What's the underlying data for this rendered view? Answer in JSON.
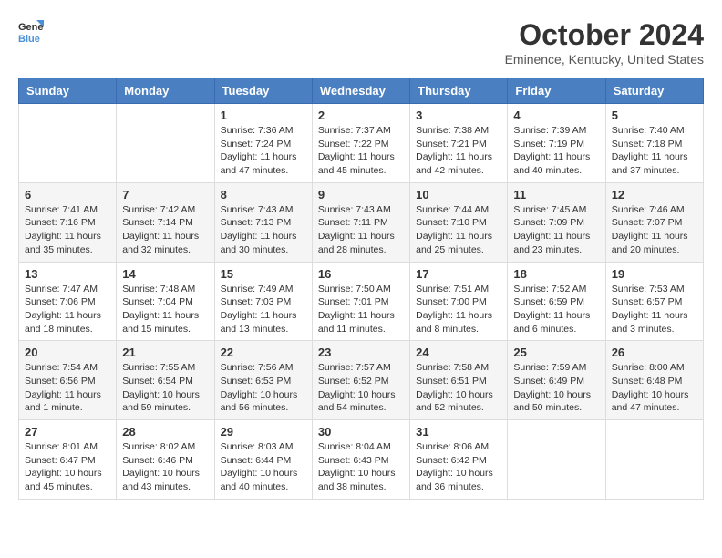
{
  "header": {
    "logo_general": "General",
    "logo_blue": "Blue",
    "month_year": "October 2024",
    "location": "Eminence, Kentucky, United States"
  },
  "weekdays": [
    "Sunday",
    "Monday",
    "Tuesday",
    "Wednesday",
    "Thursday",
    "Friday",
    "Saturday"
  ],
  "weeks": [
    [
      {
        "day": "",
        "info": ""
      },
      {
        "day": "",
        "info": ""
      },
      {
        "day": "1",
        "info": "Sunrise: 7:36 AM\nSunset: 7:24 PM\nDaylight: 11 hours and 47 minutes."
      },
      {
        "day": "2",
        "info": "Sunrise: 7:37 AM\nSunset: 7:22 PM\nDaylight: 11 hours and 45 minutes."
      },
      {
        "day": "3",
        "info": "Sunrise: 7:38 AM\nSunset: 7:21 PM\nDaylight: 11 hours and 42 minutes."
      },
      {
        "day": "4",
        "info": "Sunrise: 7:39 AM\nSunset: 7:19 PM\nDaylight: 11 hours and 40 minutes."
      },
      {
        "day": "5",
        "info": "Sunrise: 7:40 AM\nSunset: 7:18 PM\nDaylight: 11 hours and 37 minutes."
      }
    ],
    [
      {
        "day": "6",
        "info": "Sunrise: 7:41 AM\nSunset: 7:16 PM\nDaylight: 11 hours and 35 minutes."
      },
      {
        "day": "7",
        "info": "Sunrise: 7:42 AM\nSunset: 7:14 PM\nDaylight: 11 hours and 32 minutes."
      },
      {
        "day": "8",
        "info": "Sunrise: 7:43 AM\nSunset: 7:13 PM\nDaylight: 11 hours and 30 minutes."
      },
      {
        "day": "9",
        "info": "Sunrise: 7:43 AM\nSunset: 7:11 PM\nDaylight: 11 hours and 28 minutes."
      },
      {
        "day": "10",
        "info": "Sunrise: 7:44 AM\nSunset: 7:10 PM\nDaylight: 11 hours and 25 minutes."
      },
      {
        "day": "11",
        "info": "Sunrise: 7:45 AM\nSunset: 7:09 PM\nDaylight: 11 hours and 23 minutes."
      },
      {
        "day": "12",
        "info": "Sunrise: 7:46 AM\nSunset: 7:07 PM\nDaylight: 11 hours and 20 minutes."
      }
    ],
    [
      {
        "day": "13",
        "info": "Sunrise: 7:47 AM\nSunset: 7:06 PM\nDaylight: 11 hours and 18 minutes."
      },
      {
        "day": "14",
        "info": "Sunrise: 7:48 AM\nSunset: 7:04 PM\nDaylight: 11 hours and 15 minutes."
      },
      {
        "day": "15",
        "info": "Sunrise: 7:49 AM\nSunset: 7:03 PM\nDaylight: 11 hours and 13 minutes."
      },
      {
        "day": "16",
        "info": "Sunrise: 7:50 AM\nSunset: 7:01 PM\nDaylight: 11 hours and 11 minutes."
      },
      {
        "day": "17",
        "info": "Sunrise: 7:51 AM\nSunset: 7:00 PM\nDaylight: 11 hours and 8 minutes."
      },
      {
        "day": "18",
        "info": "Sunrise: 7:52 AM\nSunset: 6:59 PM\nDaylight: 11 hours and 6 minutes."
      },
      {
        "day": "19",
        "info": "Sunrise: 7:53 AM\nSunset: 6:57 PM\nDaylight: 11 hours and 3 minutes."
      }
    ],
    [
      {
        "day": "20",
        "info": "Sunrise: 7:54 AM\nSunset: 6:56 PM\nDaylight: 11 hours and 1 minute."
      },
      {
        "day": "21",
        "info": "Sunrise: 7:55 AM\nSunset: 6:54 PM\nDaylight: 10 hours and 59 minutes."
      },
      {
        "day": "22",
        "info": "Sunrise: 7:56 AM\nSunset: 6:53 PM\nDaylight: 10 hours and 56 minutes."
      },
      {
        "day": "23",
        "info": "Sunrise: 7:57 AM\nSunset: 6:52 PM\nDaylight: 10 hours and 54 minutes."
      },
      {
        "day": "24",
        "info": "Sunrise: 7:58 AM\nSunset: 6:51 PM\nDaylight: 10 hours and 52 minutes."
      },
      {
        "day": "25",
        "info": "Sunrise: 7:59 AM\nSunset: 6:49 PM\nDaylight: 10 hours and 50 minutes."
      },
      {
        "day": "26",
        "info": "Sunrise: 8:00 AM\nSunset: 6:48 PM\nDaylight: 10 hours and 47 minutes."
      }
    ],
    [
      {
        "day": "27",
        "info": "Sunrise: 8:01 AM\nSunset: 6:47 PM\nDaylight: 10 hours and 45 minutes."
      },
      {
        "day": "28",
        "info": "Sunrise: 8:02 AM\nSunset: 6:46 PM\nDaylight: 10 hours and 43 minutes."
      },
      {
        "day": "29",
        "info": "Sunrise: 8:03 AM\nSunset: 6:44 PM\nDaylight: 10 hours and 40 minutes."
      },
      {
        "day": "30",
        "info": "Sunrise: 8:04 AM\nSunset: 6:43 PM\nDaylight: 10 hours and 38 minutes."
      },
      {
        "day": "31",
        "info": "Sunrise: 8:06 AM\nSunset: 6:42 PM\nDaylight: 10 hours and 36 minutes."
      },
      {
        "day": "",
        "info": ""
      },
      {
        "day": "",
        "info": ""
      }
    ]
  ]
}
